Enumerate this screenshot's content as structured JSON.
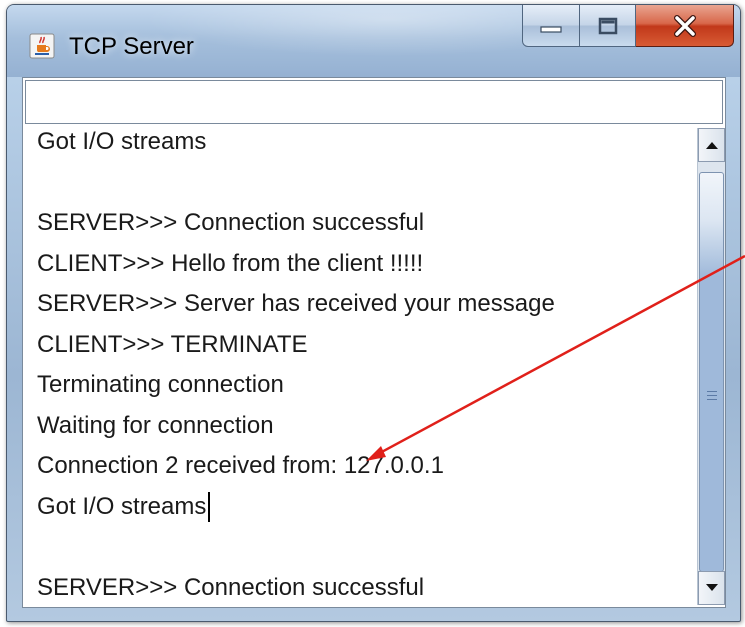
{
  "window": {
    "title": "TCP Server",
    "app_icon": "java-icon",
    "buttons": [
      {
        "name": "minimize",
        "icon": "minimize-icon"
      },
      {
        "name": "maximize",
        "icon": "maximize-icon"
      },
      {
        "name": "close",
        "icon": "close-icon"
      }
    ]
  },
  "input": {
    "value": ""
  },
  "output": {
    "lines": [
      "Got I/O streams",
      "",
      "SERVER>>> Connection successful",
      "CLIENT>>> Hello from the client !!!!!",
      "SERVER>>> Server has received your message",
      "CLIENT>>> TERMINATE",
      "Terminating connection",
      "Waiting for connection",
      "Connection 2 received from: 127.0.0.1",
      "Got I/O streams",
      "",
      "SERVER>>> Connection successful"
    ]
  },
  "scrollbar": {
    "icons": [
      "scroll-up-arrow-icon",
      "scroll-down-arrow-icon",
      "scroll-grip-icon"
    ]
  },
  "colors": {
    "annotation_arrow": "#e0201a",
    "close_button": "#c8422a",
    "titlebar": "#a5bfdc"
  }
}
